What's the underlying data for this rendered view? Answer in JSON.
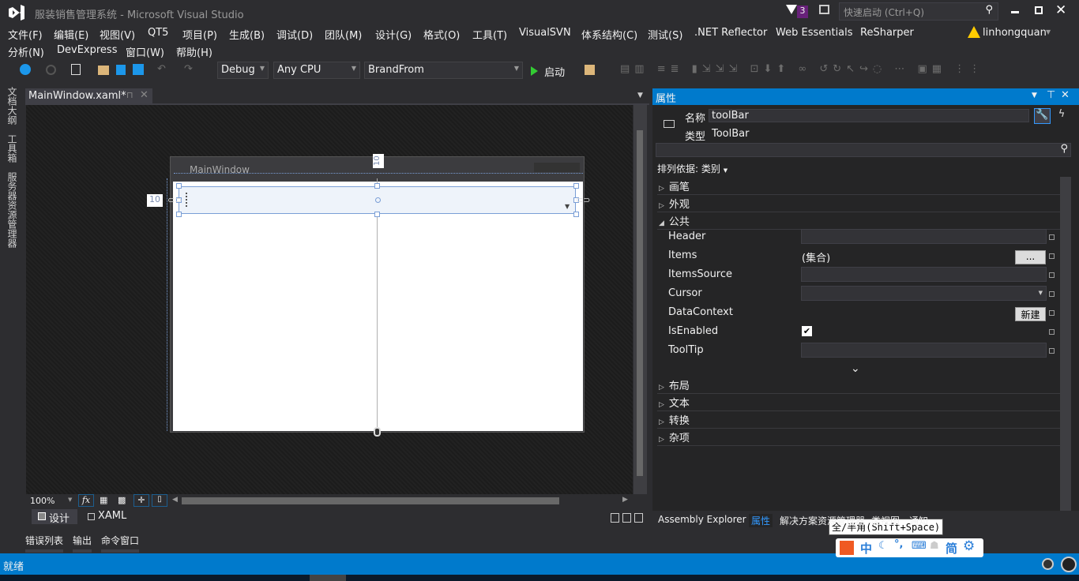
{
  "title_bar": {
    "title": "服装销售管理系统 - Microsoft Visual Studio",
    "notification_count": "3",
    "quick_launch_placeholder": "快速启动 (Ctrl+Q)"
  },
  "menu": {
    "row1": [
      "文件(F)",
      "编辑(E)",
      "视图(V)",
      "QT5",
      "项目(P)",
      "生成(B)",
      "调试(D)",
      "团队(M)",
      "设计(G)",
      "格式(O)",
      "工具(T)",
      "VisualSVN",
      "体系结构(C)",
      "测试(S)",
      ".NET Reflector",
      "Web Essentials",
      "ReSharper"
    ],
    "row2": [
      "分析(N)",
      "DevExpress",
      "窗口(W)",
      "帮助(H)"
    ],
    "user": "linhongquan"
  },
  "toolbar": {
    "configuration": "Debug",
    "platform": "Any CPU",
    "startup_project": "BrandFrom",
    "start_label": "启动"
  },
  "left_tabs": [
    "文档大纲",
    "工具箱",
    "服务器资源管理器"
  ],
  "document": {
    "tab": "MainWindow.xaml*",
    "window_title": "MainWindow",
    "margin_left": "10",
    "margin_top": "10",
    "zoom": "100%",
    "view_tabs": {
      "design": "设计",
      "xaml": "XAML"
    }
  },
  "bottom_tabs": [
    "错误列表",
    "输出",
    "命令窗口"
  ],
  "status": {
    "text": "就绪",
    "accent": "#007acc"
  },
  "properties": {
    "title": "属性",
    "name_label": "名称",
    "name_value": "toolBar",
    "type_label": "类型",
    "type_value": "ToolBar",
    "sort_label": "排列依据: 类别",
    "categories_top": [
      "画笔",
      "外观",
      "公共"
    ],
    "rows": [
      {
        "name": "Header",
        "value": ""
      },
      {
        "name": "Items",
        "value": "(集合)",
        "button": "..."
      },
      {
        "name": "ItemsSource",
        "value": ""
      },
      {
        "name": "Cursor",
        "value": ""
      },
      {
        "name": "DataContext",
        "button": "新建"
      },
      {
        "name": "IsEnabled",
        "checked": true
      },
      {
        "name": "ToolTip",
        "value": ""
      }
    ],
    "categories_bottom": [
      "布局",
      "文本",
      "转换",
      "杂项"
    ]
  },
  "panel_tabs": [
    "Assembly Explorer",
    "属性",
    "解决方案资源管理器",
    "类视图",
    "通知"
  ],
  "ime": {
    "tooltip": "全/半角(Shift+Space)",
    "items": [
      "中",
      "简"
    ]
  }
}
